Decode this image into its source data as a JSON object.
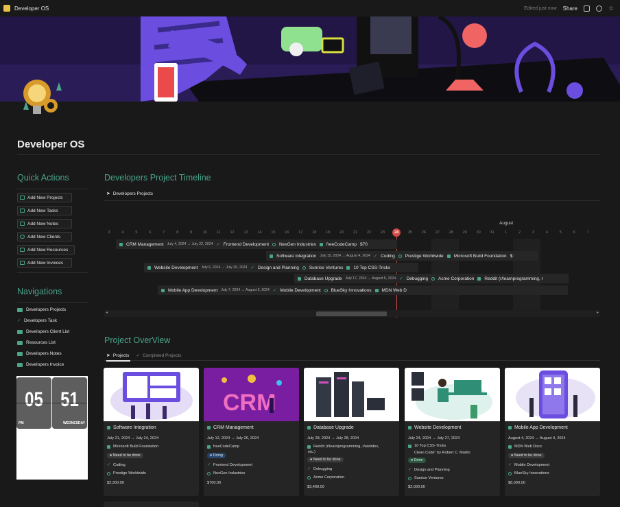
{
  "topbar": {
    "title": "Developer OS",
    "edited": "Edited just now",
    "share": "Share"
  },
  "page": {
    "title": "Developer OS"
  },
  "quick_actions": {
    "heading": "Quick Actions",
    "buttons": [
      {
        "label": "Add New Projects",
        "icon": "window-icon"
      },
      {
        "label": "Add New Tasks",
        "icon": "checklist-icon"
      },
      {
        "label": "Add New Notes",
        "icon": "notes-icon"
      },
      {
        "label": "Add New Clients",
        "icon": "user-icon"
      },
      {
        "label": "Add New Resources",
        "icon": "table-icon"
      },
      {
        "label": "Add New Invoices",
        "icon": "money-icon"
      }
    ]
  },
  "navigations": {
    "heading": "Navigations",
    "items": [
      {
        "label": "Developers Projects",
        "icon": "grid-icon"
      },
      {
        "label": "Developers Task",
        "icon": "check-icon"
      },
      {
        "label": "Developers Client List",
        "icon": "people-icon"
      },
      {
        "label": "Resources List",
        "icon": "tree-icon"
      },
      {
        "label": "Developers Notes",
        "icon": "table-icon"
      },
      {
        "label": "Developers Invoice",
        "icon": "invoice-icon"
      }
    ]
  },
  "clock": {
    "hour": "05",
    "minute": "51",
    "ampm": "PM",
    "weekday": "WEDNESDAY"
  },
  "timeline": {
    "heading": "Developers Project Timeline",
    "view_tab": "Developers Projects",
    "month": "August",
    "days": [
      "3",
      "4",
      "5",
      "6",
      "7",
      "8",
      "9",
      "10",
      "11",
      "12",
      "13",
      "14",
      "15",
      "16",
      "17",
      "18",
      "19",
      "20",
      "21",
      "22",
      "23",
      "24",
      "25",
      "26",
      "27",
      "28",
      "29",
      "30",
      "31",
      "1",
      "2",
      "3",
      "4",
      "5",
      "6",
      "7"
    ],
    "today": "24",
    "bars": [
      {
        "name": "CRM Management",
        "dates": "July 4, 2024 → July 22, 2024",
        "tag": "Frontend Development",
        "client": "NexGen Industries",
        "resource": "freeCodeCamp",
        "amount": "$70"
      },
      {
        "name": "Software Integration",
        "dates": "July 15, 2024 → August 4, 2024",
        "tag": "Coding",
        "client": "Prestige Worldwide",
        "resource": "Microsoft Build Foundation",
        "amount": "$:"
      },
      {
        "name": "Website Development",
        "dates": "July 6, 2024 → July 26, 2024",
        "tag": "Design and Planning",
        "client": "Sunrise Ventures",
        "resource": "10 Top CSS-Tricks",
        "amount": ""
      },
      {
        "name": "Database Upgrade",
        "dates": "July 17, 2024 → August 5, 2024",
        "tag": "Debugging",
        "client": "Acme Corporation",
        "resource": "Reddit (r/learnprogramming, r",
        "amount": ""
      },
      {
        "name": "Mobile App Development",
        "dates": "July 7, 2024 → August 5, 2024",
        "tag": "Mobile Development",
        "client": "BlueSky Innovations",
        "resource": "MDN Web D",
        "amount": ""
      }
    ]
  },
  "overview": {
    "heading": "Project OverView",
    "tabs": [
      "Projects",
      "Completed Projects"
    ],
    "cards": [
      {
        "title": "Software Integration",
        "dates": "July 21, 2024 → July 24, 2024",
        "resource": "Microsoft Build Foundation",
        "resource2": "",
        "status": "Need to be done",
        "tag": "Coding",
        "client": "Prestige Worldwide",
        "amount": "$2,300.00"
      },
      {
        "title": "CRM Management",
        "dates": "July 12, 2024 → July 26, 2024",
        "resource": "freeCodeCamp",
        "resource2": "",
        "status": "Doing",
        "tag": "Frontend Development",
        "client": "NexGen Industries",
        "amount": "$700.00"
      },
      {
        "title": "Database Upgrade",
        "dates": "July 28, 2024 → July 28, 2024",
        "resource": "Reddit (r/learnprogramming, r/webdev,",
        "resource2": "etc.)",
        "status": "Need to be done",
        "tag": "Debugging",
        "client": "Acme Corporation",
        "amount": "$3,400.00"
      },
      {
        "title": "Website Development",
        "dates": "July 24, 2024 → July 27, 2024",
        "resource": "10 Top CSS-Tricks",
        "resource2": "Clean Code\" by Robert C. Martin",
        "status": "Done",
        "tag": "Design and Planning",
        "client": "Sunrise Ventures",
        "amount": "$2,000.00"
      },
      {
        "title": "Mobile App Development",
        "dates": "August 4, 2024 → August 4, 2024",
        "resource": "MDN Web Docs",
        "resource2": "",
        "status": "Need to be done",
        "tag": "Mobile Development",
        "client": "BlueSky Innovations",
        "amount": "$8,000.00"
      }
    ]
  },
  "colors": {
    "accent": "#4aa58b",
    "background": "#191919",
    "today": "#d44c47",
    "status_need": "#3b3b3b",
    "status_doing": "#28456c",
    "status_done": "#2b593f"
  }
}
